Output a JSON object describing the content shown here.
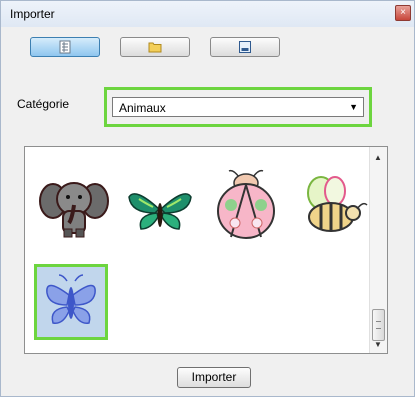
{
  "window": {
    "title": "Importer",
    "close_symbol": "×"
  },
  "toolbar": {
    "buttons": [
      {
        "icon": "grid-list-icon",
        "active": true
      },
      {
        "icon": "folder-icon",
        "active": false
      },
      {
        "icon": "picture-icon",
        "active": false
      }
    ]
  },
  "category": {
    "label": "Catégorie",
    "selected": "Animaux",
    "arrow": "▼"
  },
  "gallery": {
    "items": [
      {
        "icon": "elephant-icon"
      },
      {
        "icon": "butterfly-icon"
      },
      {
        "icon": "ladybug-icon"
      },
      {
        "icon": "bee-icon"
      },
      {
        "icon": "blue-butterfly-icon",
        "selected": true
      }
    ],
    "scroll_up": "▲",
    "scroll_down": "▼"
  },
  "actions": {
    "import_label": "Importer"
  },
  "colors": {
    "highlight": "#6dd53f",
    "active_button": "#8fc6ef"
  }
}
